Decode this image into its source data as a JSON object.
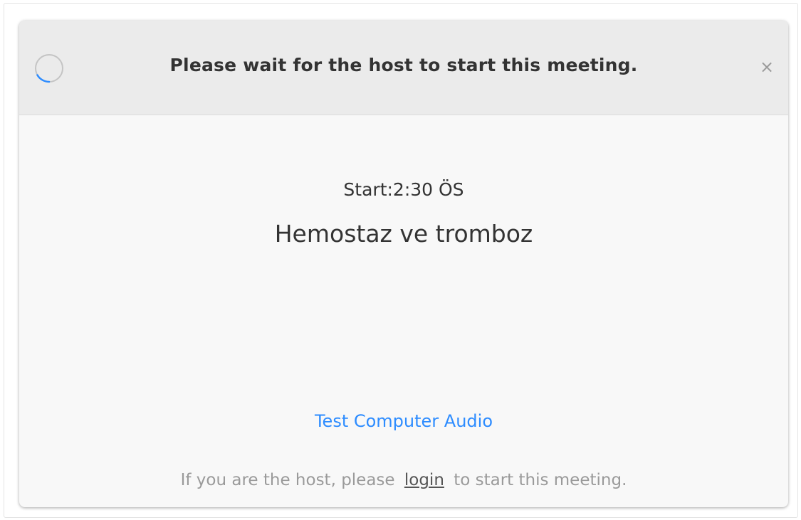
{
  "header": {
    "title": "Please wait for the host to start this meeting.",
    "close_symbol": "×",
    "spinner_icon": "loading-spinner-icon",
    "close_icon": "close-icon"
  },
  "meeting": {
    "start_time": "Start:2:30 ÖS",
    "topic": "Hemostaz ve tromboz"
  },
  "actions": {
    "test_audio": "Test Computer Audio"
  },
  "footer": {
    "prefix": "If you are the host, please",
    "login": "login",
    "suffix": "to start this meeting."
  },
  "colors": {
    "link": "#2d8cff",
    "header_bg": "#ebebeb",
    "body_bg": "#f8f8f8",
    "text": "#333333",
    "muted": "#9a9a9a",
    "spinner_accent": "#2d8cff"
  }
}
